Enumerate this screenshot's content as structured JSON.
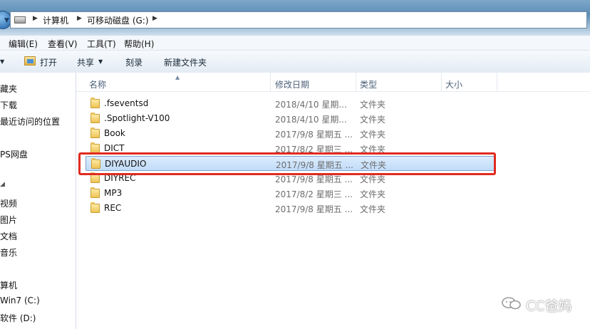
{
  "address": {
    "crumbs": [
      "计算机",
      "可移动磁盘 (G:)"
    ]
  },
  "menu": [
    "编辑(E)",
    "查看(V)",
    "工具(T)",
    "帮助(H)"
  ],
  "toolbar": {
    "open_label": "打开",
    "share_label": "共享",
    "burn_label": "刻录",
    "new_folder_label": "新建文件夹"
  },
  "nav": {
    "items": [
      "藏夹",
      "下载",
      "最近访问的位置",
      "PS网盘",
      "视频",
      "图片",
      "文档",
      "音乐",
      "算机",
      "Win7 (C:)",
      "软件 (D:)"
    ]
  },
  "columns": {
    "name": "名称",
    "date": "修改日期",
    "type": "类型",
    "size": "大小"
  },
  "files": [
    {
      "name": ".fseventsd",
      "date": "2018/4/10 星期...",
      "type": "文件夹"
    },
    {
      "name": ".Spotlight-V100",
      "date": "2018/4/10 星期...",
      "type": "文件夹"
    },
    {
      "name": "Book",
      "date": "2017/9/8 星期五 ...",
      "type": "文件夹"
    },
    {
      "name": "DICT",
      "date": "2017/8/2 星期三 ...",
      "type": "文件夹"
    },
    {
      "name": "DIYAUDIO",
      "date": "2017/9/8 星期五 ...",
      "type": "文件夹",
      "selected": true
    },
    {
      "name": "DIYREC",
      "date": "2017/9/8 星期五 ...",
      "type": "文件夹"
    },
    {
      "name": "MP3",
      "date": "2017/8/2 星期三 ...",
      "type": "文件夹"
    },
    {
      "name": "REC",
      "date": "2017/9/8 星期五 ...",
      "type": "文件夹"
    }
  ],
  "watermark": "CC爸妈",
  "colors": {
    "selection": "#c1dcf9",
    "highlight_border": "#e02b20"
  }
}
